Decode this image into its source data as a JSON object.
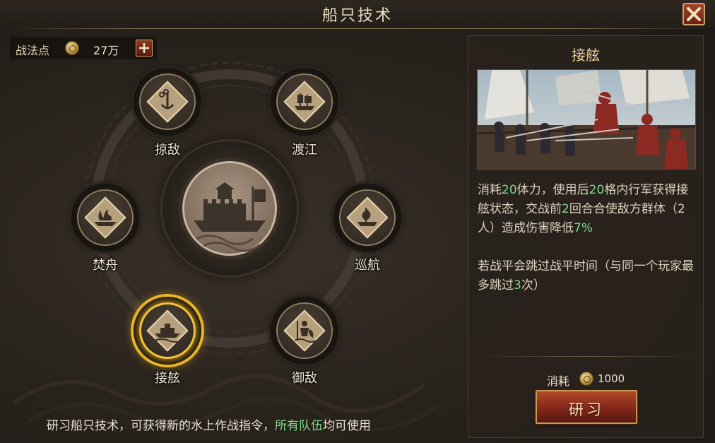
{
  "window": {
    "title": "船只技术",
    "close_icon": "close-icon"
  },
  "points": {
    "label": "战法点",
    "value": "27万",
    "coin_icon": "coin-icon",
    "add_icon": "plus-icon"
  },
  "techs": [
    {
      "id": "lue-di",
      "label": "掠敌",
      "icon": "chain-anchor-icon"
    },
    {
      "id": "du-jiang",
      "label": "渡江",
      "icon": "junk-ship-icon"
    },
    {
      "id": "fen-zhou",
      "label": "焚舟",
      "icon": "burning-ship-icon"
    },
    {
      "id": "xun-hang",
      "label": "巡航",
      "icon": "sailing-ship-icon"
    },
    {
      "id": "jie-xian",
      "label": "接舷",
      "icon": "boarding-boat-icon",
      "selected": true
    },
    {
      "id": "yu-di",
      "label": "御敌",
      "icon": "shield-soldier-icon"
    }
  ],
  "center": {
    "icon": "warship-icon"
  },
  "hint": {
    "prefix": "研习船只技术，可获得新的水上作战指令，",
    "highlight": "所有队伍",
    "suffix": "均可使用"
  },
  "detail": {
    "title": "接舷",
    "image": "boarding-battle-illustration",
    "desc1": [
      {
        "t": "消耗"
      },
      {
        "t": "20",
        "g": true
      },
      {
        "t": "体力，使用后"
      },
      {
        "t": "20",
        "g": true
      },
      {
        "t": "格内行军获得接舷状态，交战前"
      },
      {
        "t": "2",
        "g": true
      },
      {
        "t": "回合合使敌方群体（2人）造成伤害降低"
      },
      {
        "t": "7%",
        "g": true
      }
    ],
    "desc2": [
      {
        "t": "若战平会跳过战平时间（与同一个玩家最多跳过"
      },
      {
        "t": "3",
        "g": true
      },
      {
        "t": "次）"
      }
    ],
    "cost_label": "消耗",
    "cost_value": "1000",
    "study_label": "研习"
  },
  "colors": {
    "highlight_green": "#7ddc8b",
    "gold_accent": "#e8b22a",
    "button_red": "#82271a"
  }
}
